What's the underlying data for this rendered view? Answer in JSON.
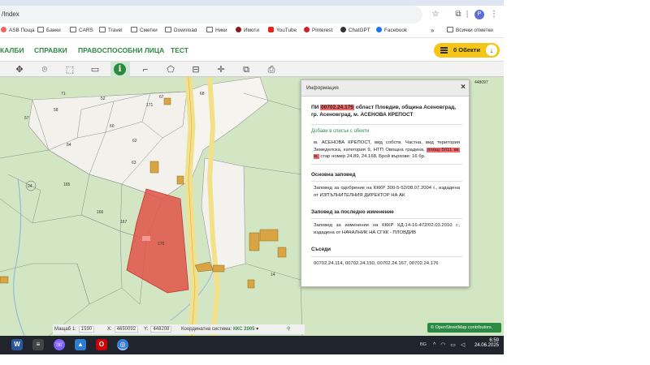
{
  "browser": {
    "url": "/Index",
    "profile_initial": "P",
    "bookmarks": [
      {
        "label": "ASB Пощa",
        "icon": "dot"
      },
      {
        "label": "Банки",
        "icon": "folder-icon"
      },
      {
        "label": "CARS",
        "icon": "folder-icon"
      },
      {
        "label": "Travel",
        "icon": "folder-icon"
      },
      {
        "label": "Сметки",
        "icon": "folder-icon"
      },
      {
        "label": "Download",
        "icon": "folder-icon"
      },
      {
        "label": "Ники",
        "icon": "folder-icon"
      },
      {
        "label": "Имоти",
        "icon": "dot"
      },
      {
        "label": "YouTube",
        "icon": "dot"
      },
      {
        "label": "Pinterest",
        "icon": "dot"
      },
      {
        "label": "ChatGPT",
        "icon": "dot"
      },
      {
        "label": "Facebook",
        "icon": "dot"
      }
    ],
    "more_bookmarks": "»",
    "all_bookmarks": "Всички отметки"
  },
  "menu": {
    "items": [
      "КАЛБИ",
      "СПРАВКИ",
      "ПРАВОСПОСОБНИ ЛИЦА",
      "ТЕСТ"
    ],
    "objects_label": "0 Обекти"
  },
  "toolbar": {
    "tools": [
      "pan-icon",
      "pin-icon",
      "rectangle-select-icon",
      "rectangle-icon",
      "info-icon",
      "corner-icon",
      "polygon-icon",
      "map-icon",
      "crosshair-icon",
      "export-icon",
      "print-icon"
    ]
  },
  "map": {
    "plot_labels": [
      "71",
      "52",
      "67",
      "68",
      "57",
      "58",
      "171",
      "60",
      "62",
      "64",
      "63",
      "24",
      "165",
      "166",
      "167",
      "176",
      "14",
      "448097"
    ]
  },
  "info": {
    "title": "Информация",
    "close": "×",
    "heading_prefix": "ПИ ",
    "heading_id": "00702.24.175",
    "heading_rest": " област Пловдив, община Асеновград, гр. Асеновград, м. АСЕНОВА КРЕПОСТ",
    "add_link": "Добави в списък с обекти",
    "desc_part1": "м. АСЕНОВА КРЕПОСТ, вид собств. Частна, вид територия Земеделска, категория 9, НТП Овощна градина, ",
    "desc_area": "площ 5011 кв. м,",
    "desc_part2": " стар номер 24.89, 24.168, Брой върхове: 16 бр.",
    "sections": [
      {
        "title": "Основна заповед",
        "body": "Заповед за одобрение на КККР 300-5-52/08.07.2004 г., издадена от ИЗПЪЛНИТЕЛНИЯ ДИРЕКТОР НА АК"
      },
      {
        "title": "Заповед за последно изменение",
        "body": "Заповед за изменение на КККР КД-14-16-472/02.03.2010 г., издадена от НАЧАЛНИК НА СГКК - ПЛОВДИВ"
      },
      {
        "title": "Съседи",
        "body": "00702.24.114, 00702.24.150, 00702.24.167, 00702.24.176"
      }
    ]
  },
  "status": {
    "scale_label": "Мащаб 1:",
    "scale_value": "1590",
    "x_label": "X:",
    "x_value": "4650092",
    "y_label": "Y:",
    "y_value": "448208",
    "crs_label": "Координатна система:",
    "crs_value": "ККС 2005",
    "osm_text": "© OpenStreetMap contributors."
  },
  "taskbar": {
    "lang": "BG",
    "time": "6:59",
    "date": "24.06.2025"
  },
  "colors": {
    "accent_green": "#2f8a43",
    "highlight_red": "#f06a6a",
    "parcel_red": "#e0534a",
    "objects_yellow": "#f5c518"
  }
}
